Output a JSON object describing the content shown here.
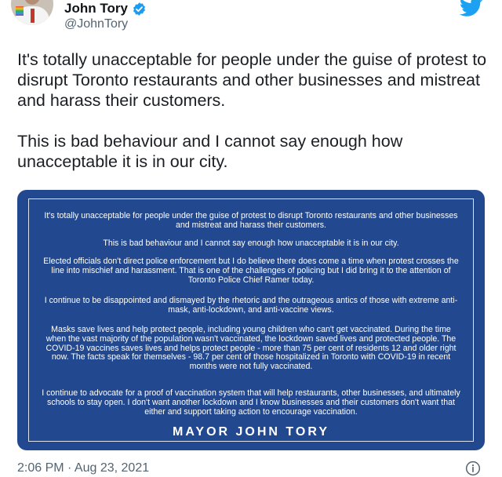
{
  "author": {
    "display_name": "John Tory",
    "handle": "@JohnTory"
  },
  "icons": {
    "verified": "verified-badge-icon",
    "platform": "twitter-bird-icon",
    "info": "info-icon"
  },
  "colors": {
    "verified": "#1d9bf0",
    "twitter_blue": "#1da1f2",
    "card_background": "#22488f",
    "secondary_text": "#536471"
  },
  "tweet": {
    "text": "It's totally unacceptable for people under the guise of protest to disrupt Toronto restaurants and other businesses and mistreat and harass their customers.\n\nThis is bad behaviour and I cannot say enough how unacceptable it is in our city.",
    "timestamp": "2:06 PM · Aug 23, 2021"
  },
  "statement_card": {
    "paragraphs": [
      "It's totally unacceptable for people under the guise of protest to disrupt Toronto restaurants and other businesses and mistreat and harass their customers.",
      "This is bad behaviour and I cannot say enough how unacceptable it is in our city.",
      "Elected officials don't direct police enforcement but I do believe there does come a time when protest crosses the line into mischief and harassment. That is one of the challenges of policing but I did bring it to the attention of Toronto Police Chief Ramer today.",
      "I continue to be disappointed and dismayed by the rhetoric and the outrageous antics of those with extreme anti-mask, anti-lockdown, and anti-vaccine views.",
      "Masks save lives and help protect people, including young children who can't get vaccinated. During the time when the vast majority of the population wasn't vaccinated, the lockdown saved lives and protected people. The COVID-19 vaccines saves lives and helps protect people - more than 75 per cent of residents 12 and older right now. The facts speak for themselves - 98.7 per cent of those hospitalized in Toronto with COVID-19 in recent months were not fully vaccinated.",
      "I continue to advocate for a proof of vaccination system that will help restaurants, other businesses, and ultimately schools to stay open. I don't want another lockdown and I know businesses and their customers don't want that either and support taking action to encourage vaccination."
    ],
    "signature": "MAYOR JOHN TORY"
  }
}
